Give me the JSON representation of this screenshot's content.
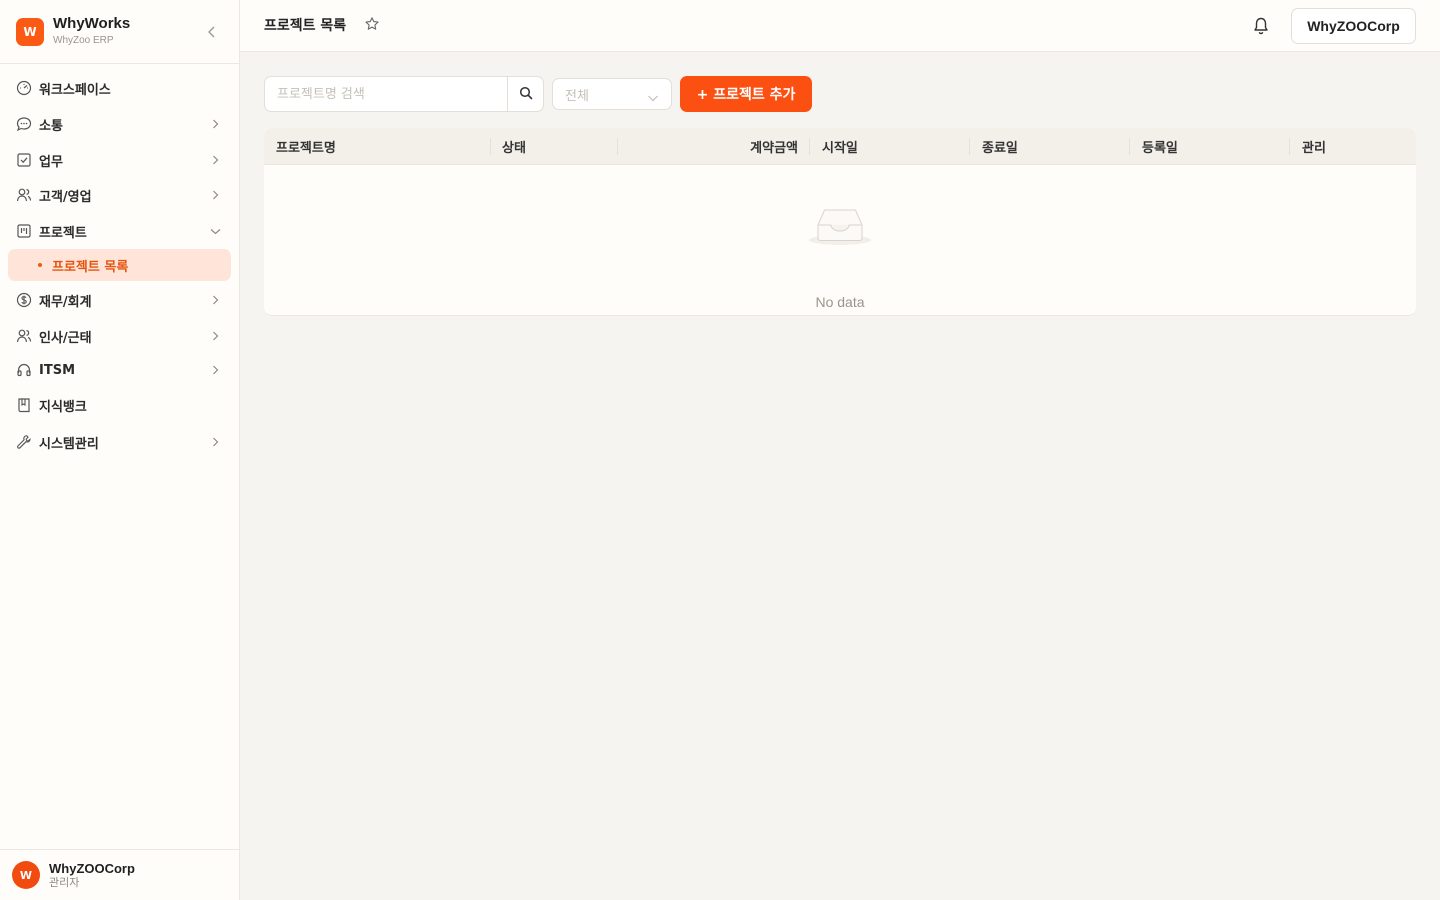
{
  "brand": {
    "logo_letter": "W",
    "name": "WhyWorks",
    "subtitle": "WhyZoo ERP"
  },
  "sidebar": {
    "items": [
      {
        "label": "워크스페이스",
        "icon": "dashboard-icon",
        "has_children": false
      },
      {
        "label": "소통",
        "icon": "chat-icon",
        "has_children": true
      },
      {
        "label": "업무",
        "icon": "checkbox-icon",
        "has_children": true
      },
      {
        "label": "고객/영업",
        "icon": "users-icon",
        "has_children": true
      },
      {
        "label": "프로젝트",
        "icon": "kanban-icon",
        "has_children": true,
        "expanded": true
      },
      {
        "label": "재무/회계",
        "icon": "dollar-icon",
        "has_children": true
      },
      {
        "label": "인사/근태",
        "icon": "users-icon",
        "has_children": true
      },
      {
        "label": "ITSM",
        "icon": "headset-icon",
        "has_children": true
      },
      {
        "label": "지식뱅크",
        "icon": "book-icon",
        "has_children": false
      },
      {
        "label": "시스템관리",
        "icon": "wrench-icon",
        "has_children": true
      }
    ],
    "active_sub": {
      "label": "프로젝트 목록"
    }
  },
  "user": {
    "avatar_letter": "W",
    "name": "WhyZOOCorp",
    "role": "관리자"
  },
  "header": {
    "title": "프로젝트 목록",
    "company": "WhyZOOCorp"
  },
  "toolbar": {
    "search_placeholder": "프로젝트명 검색",
    "status_value": "전체",
    "add_label": "+ 프로젝트 추가"
  },
  "table": {
    "columns": [
      "프로젝트명",
      "상태",
      "계약금액",
      "시작일",
      "종료일",
      "등록일",
      "관리"
    ],
    "empty_text": "No data"
  },
  "colors": {
    "accent": "#fb5012",
    "active_bg": "#ffe5d9"
  }
}
